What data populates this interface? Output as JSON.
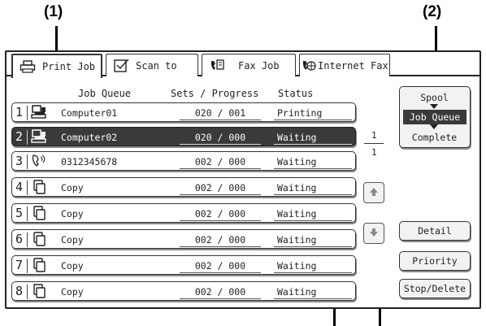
{
  "callouts": [
    "(1)",
    "(2)"
  ],
  "tabs": [
    {
      "label": "Print Job",
      "icon": "printer-icon",
      "active": true
    },
    {
      "label": "Scan to",
      "icon": "scan-icon",
      "active": false
    },
    {
      "label": "Fax Job",
      "icon": "fax-icon",
      "active": false
    },
    {
      "label": "Internet Fax",
      "icon": "internet-fax-icon",
      "active": false
    }
  ],
  "headers": {
    "queue": "Job Queue",
    "progress": "Sets / Progress",
    "status": "Status"
  },
  "jobs": [
    {
      "num": "1",
      "icon": "computer-icon",
      "name": "Computer01",
      "progress": "020 / 001",
      "status": "Printing",
      "selected": false
    },
    {
      "num": "2",
      "icon": "computer-icon",
      "name": "Computer02",
      "progress": "020 / 000",
      "status": "Waiting",
      "selected": true
    },
    {
      "num": "3",
      "icon": "fax-phone-icon",
      "name": "0312345678",
      "progress": "002 / 000",
      "status": "Waiting",
      "selected": false
    },
    {
      "num": "4",
      "icon": "copy-icon",
      "name": "Copy",
      "progress": "002 / 000",
      "status": "Waiting",
      "selected": false
    },
    {
      "num": "5",
      "icon": "copy-icon",
      "name": "Copy",
      "progress": "002 / 000",
      "status": "Waiting",
      "selected": false
    },
    {
      "num": "6",
      "icon": "copy-icon",
      "name": "Copy",
      "progress": "002 / 000",
      "status": "Waiting",
      "selected": false
    },
    {
      "num": "7",
      "icon": "copy-icon",
      "name": "Copy",
      "progress": "002 / 000",
      "status": "Waiting",
      "selected": false
    },
    {
      "num": "8",
      "icon": "copy-icon",
      "name": "Copy",
      "progress": "002 / 000",
      "status": "Waiting",
      "selected": false
    }
  ],
  "page": {
    "current": "1",
    "total": "1"
  },
  "mode_switch": {
    "spool": "Spool",
    "job_queue": "Job Queue",
    "complete": "Complete"
  },
  "buttons": {
    "detail": "Detail",
    "priority": "Priority",
    "stop_delete": "Stop/Delete"
  }
}
